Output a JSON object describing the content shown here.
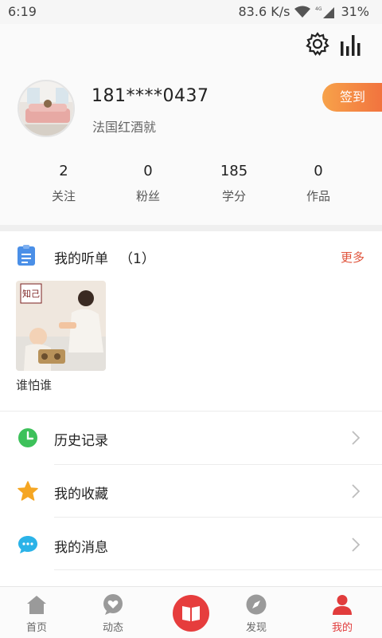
{
  "status_bar": {
    "time": "6:19",
    "network_speed": "83.6 K/s",
    "network_type": "4G",
    "battery": "31%"
  },
  "profile": {
    "phone": "181****0437",
    "nickname": "法国红酒就",
    "checkin_label": "签到"
  },
  "stats": [
    {
      "value": "2",
      "label": "关注"
    },
    {
      "value": "0",
      "label": "粉丝"
    },
    {
      "value": "185",
      "label": "学分"
    },
    {
      "value": "0",
      "label": "作品"
    }
  ],
  "playlist": {
    "title": "我的听单",
    "count": "（1）",
    "more": "更多",
    "albums": [
      {
        "name": "谁怕谁",
        "thumb_logo": "知己"
      }
    ]
  },
  "menu": [
    {
      "label": "历史记录",
      "icon": "clock-icon",
      "color": "#3dc15a"
    },
    {
      "label": "我的收藏",
      "icon": "star-icon",
      "color": "#f5a623"
    },
    {
      "label": "我的消息",
      "icon": "chat-icon",
      "color": "#2bb3e8"
    }
  ],
  "tabbar": {
    "items": [
      {
        "label": "首页",
        "icon": "home-icon"
      },
      {
        "label": "动态",
        "icon": "heart-bubble-icon"
      },
      {
        "label": "",
        "icon": "book-icon"
      },
      {
        "label": "发现",
        "icon": "compass-icon"
      },
      {
        "label": "我的",
        "icon": "user-icon",
        "active": true
      }
    ]
  },
  "colors": {
    "accent": "#e13c3c",
    "more_link": "#e0553d",
    "checkin_gradient_start": "#f7a24a",
    "checkin_gradient_end": "#f06a3c"
  }
}
